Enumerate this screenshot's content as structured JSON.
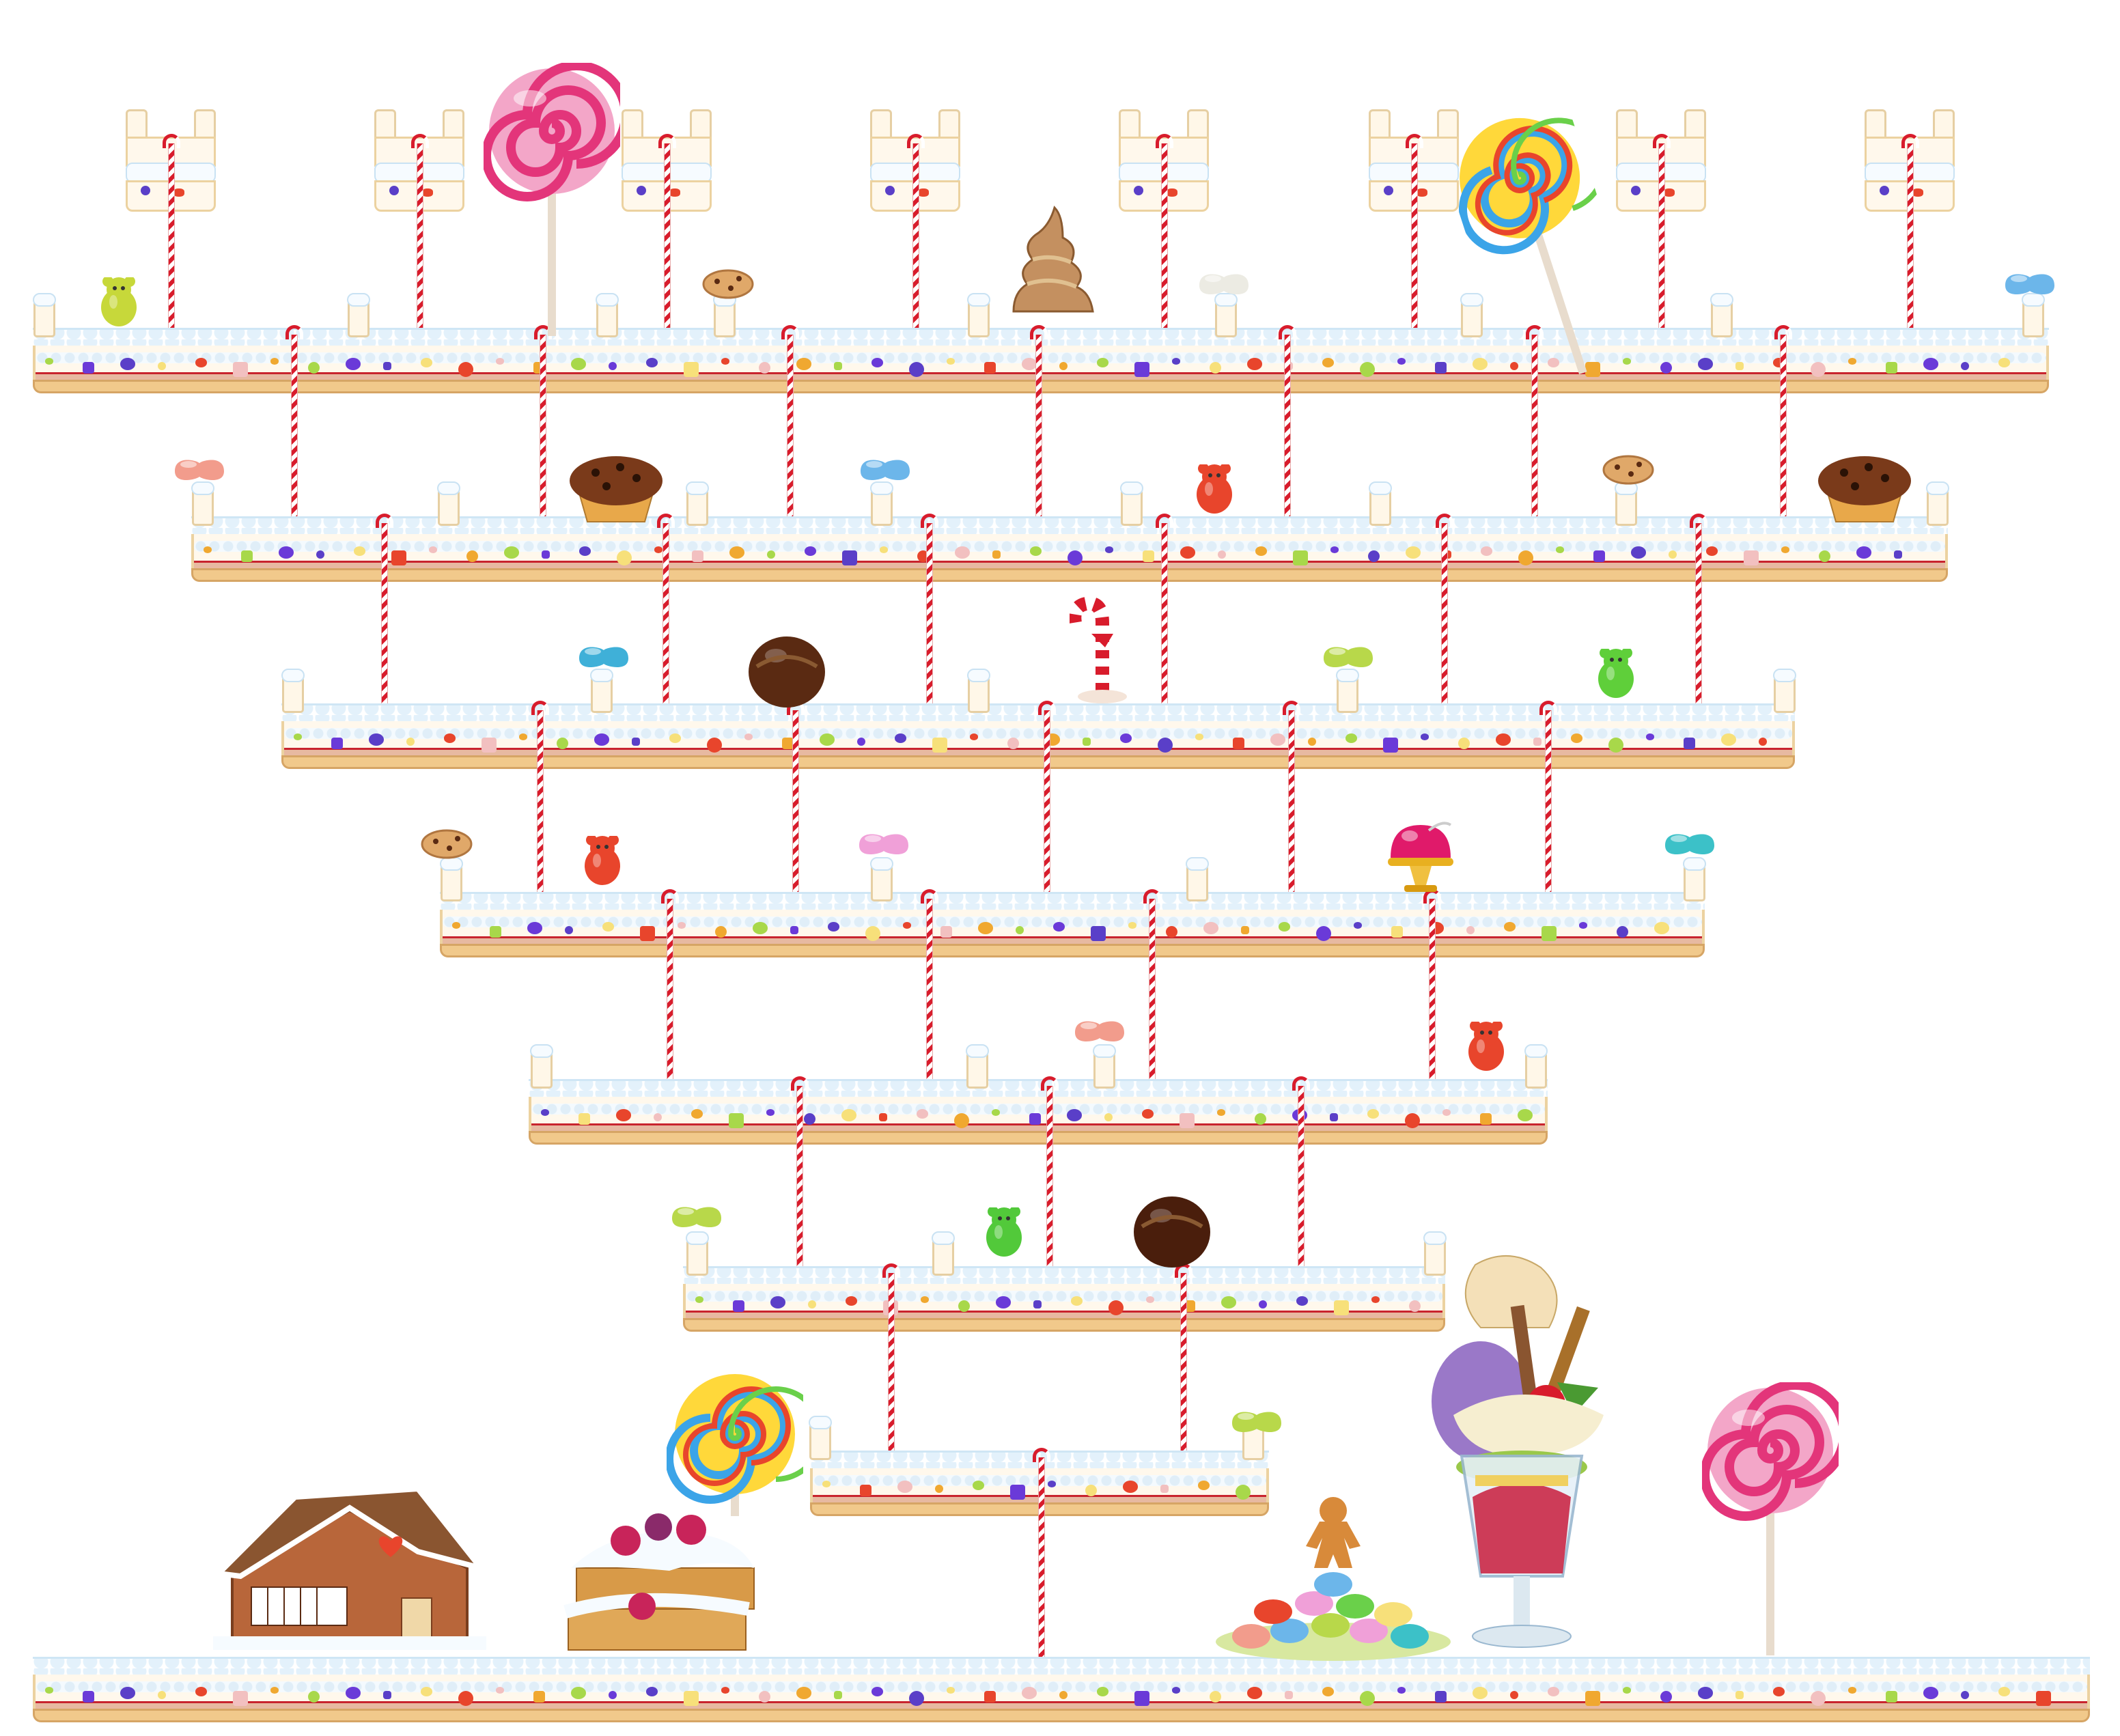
{
  "scene": {
    "type": "candy-platformer-level-map",
    "background": "#ffffff",
    "colors": {
      "frosting": "#f6fbff",
      "frosting_edge": "#c9e2f3",
      "cake": "#fff8ec",
      "crust": "#f1c98b",
      "jam": "#c8242e",
      "rope_red": "#d81c2c",
      "rope_white": "#ffffff"
    },
    "tiers": [
      {
        "name": "tier-1",
        "platforms": 1
      },
      {
        "name": "tier-2",
        "platforms": 1
      },
      {
        "name": "tier-3",
        "platforms": 1
      },
      {
        "name": "tier-4",
        "platforms": 1
      },
      {
        "name": "tier-5",
        "platforms": 1
      },
      {
        "name": "tier-6",
        "platforms": 1
      },
      {
        "name": "tier-7",
        "platforms": 1
      },
      {
        "name": "tier-8",
        "platforms": 1
      },
      {
        "name": "ground",
        "platforms": 1
      }
    ],
    "small_towers_count": 8,
    "collectibles": [
      {
        "kind": "gummy-bear",
        "color": "#c7d83a"
      },
      {
        "kind": "gummy-bear",
        "color": "#e8452c"
      },
      {
        "kind": "gummy-bear",
        "color": "#5fcf3a"
      },
      {
        "kind": "gummy-bear",
        "color": "#e8452c"
      },
      {
        "kind": "gummy-bear",
        "color": "#e8452c"
      },
      {
        "kind": "gummy-bear",
        "color": "#52c93a"
      },
      {
        "kind": "jelly-bean",
        "color": "#6cb6ea"
      },
      {
        "kind": "jelly-bean",
        "color": "#f29c8c"
      },
      {
        "kind": "jelly-bean",
        "color": "#6cb6ea"
      },
      {
        "kind": "jelly-bean",
        "color": "#3fb0d8"
      },
      {
        "kind": "jelly-bean",
        "color": "#b8d84a"
      },
      {
        "kind": "jelly-bean",
        "color": "#f0a0d8"
      },
      {
        "kind": "jelly-bean",
        "color": "#3cc1c8"
      },
      {
        "kind": "jelly-bean",
        "color": "#f29c8c"
      },
      {
        "kind": "jelly-bean",
        "color": "#b8d84a"
      },
      {
        "kind": "jelly-bean",
        "color": "#b8d84a"
      },
      {
        "kind": "jelly-bean",
        "color": "#ecebe3"
      },
      {
        "kind": "cookie",
        "color": "#e0a869"
      },
      {
        "kind": "cookie",
        "color": "#e0a869"
      },
      {
        "kind": "cookie",
        "color": "#e0a869"
      },
      {
        "kind": "muffin",
        "color": "#7a3a1a"
      },
      {
        "kind": "muffin",
        "color": "#7a3a1a"
      },
      {
        "kind": "truffle",
        "color": "#5a2a12"
      },
      {
        "kind": "truffle",
        "color": "#4a1e0c"
      },
      {
        "kind": "soft-serve",
        "color": "#c49060"
      },
      {
        "kind": "candy-cane",
        "color": "#d81c2c"
      },
      {
        "kind": "jelly-dessert",
        "color": "#e01a6a"
      },
      {
        "kind": "lollipop-swirl-pink",
        "color": "#e3357a"
      },
      {
        "kind": "lollipop-rainbow",
        "color": "#3ba4e8"
      },
      {
        "kind": "lollipop-rainbow",
        "color": "#3ba4e8"
      },
      {
        "kind": "lollipop-swirl-pink",
        "color": "#e3357a"
      }
    ],
    "ground_props": [
      {
        "kind": "gingerbread-house"
      },
      {
        "kind": "berry-cake"
      },
      {
        "kind": "candy-pile-with-gingerbread-man"
      },
      {
        "kind": "ice-cream-sundae"
      }
    ]
  }
}
